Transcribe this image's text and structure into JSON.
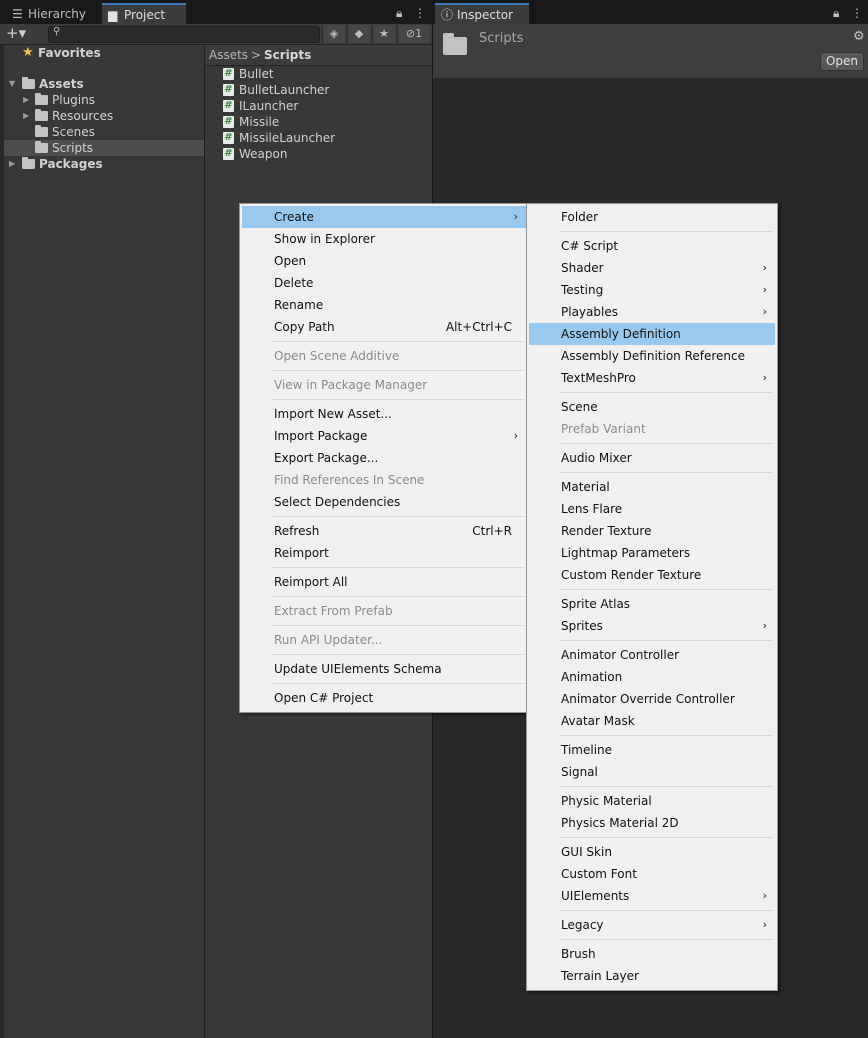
{
  "project_panel": {
    "tabs": [
      {
        "label": "Hierarchy",
        "icon": "list-icon"
      },
      {
        "label": "Project",
        "icon": "folder-icon"
      }
    ],
    "toolbar": {
      "add_label": "+▾",
      "hidden_count": "1"
    },
    "tree": {
      "favorites": "Favorites",
      "assets": "Assets",
      "plugins": "Plugins",
      "resources": "Resources",
      "scenes": "Scenes",
      "scripts": "Scripts",
      "packages": "Packages"
    },
    "breadcrumb": {
      "root": "Assets",
      "separator": ">",
      "current": "Scripts"
    },
    "files": [
      "Bullet",
      "BulletLauncher",
      "ILauncher",
      "Missile",
      "MissileLauncher",
      "Weapon"
    ]
  },
  "inspector": {
    "tab_label": "Inspector",
    "object_name": "Scripts",
    "open_button": "Open"
  },
  "context_menu": {
    "create": "Create",
    "show_in_explorer": "Show in Explorer",
    "open": "Open",
    "delete": "Delete",
    "rename": "Rename",
    "copy_path": "Copy Path",
    "copy_path_shortcut": "Alt+Ctrl+C",
    "open_scene_additive": "Open Scene Additive",
    "view_in_package_manager": "View in Package Manager",
    "import_new_asset": "Import New Asset...",
    "import_package": "Import Package",
    "export_package": "Export Package...",
    "find_references": "Find References In Scene",
    "select_dependencies": "Select Dependencies",
    "refresh": "Refresh",
    "refresh_shortcut": "Ctrl+R",
    "reimport": "Reimport",
    "reimport_all": "Reimport All",
    "extract_from_prefab": "Extract From Prefab",
    "run_api_updater": "Run API Updater...",
    "update_uielements_schema": "Update UIElements Schema",
    "open_csharp_project": "Open C# Project"
  },
  "create_submenu": {
    "folder": "Folder",
    "csharp_script": "C# Script",
    "shader": "Shader",
    "testing": "Testing",
    "playables": "Playables",
    "assembly_definition": "Assembly Definition",
    "assembly_definition_reference": "Assembly Definition Reference",
    "textmeshpro": "TextMeshPro",
    "scene": "Scene",
    "prefab_variant": "Prefab Variant",
    "audio_mixer": "Audio Mixer",
    "material": "Material",
    "lens_flare": "Lens Flare",
    "render_texture": "Render Texture",
    "lightmap_parameters": "Lightmap Parameters",
    "custom_render_texture": "Custom Render Texture",
    "sprite_atlas": "Sprite Atlas",
    "sprites": "Sprites",
    "animator_controller": "Animator Controller",
    "animation": "Animation",
    "animator_override_controller": "Animator Override Controller",
    "avatar_mask": "Avatar Mask",
    "timeline": "Timeline",
    "signal": "Signal",
    "physic_material": "Physic Material",
    "physics_material_2d": "Physics Material 2D",
    "gui_skin": "GUI Skin",
    "custom_font": "Custom Font",
    "uielements": "UIElements",
    "legacy": "Legacy",
    "brush": "Brush",
    "terrain_layer": "Terrain Layer"
  },
  "colors": {
    "menu_bg": "#f0f0f0",
    "menu_highlight": "#99c9ef",
    "panel_bg": "#383838",
    "tab_accent": "#3a79bb"
  }
}
